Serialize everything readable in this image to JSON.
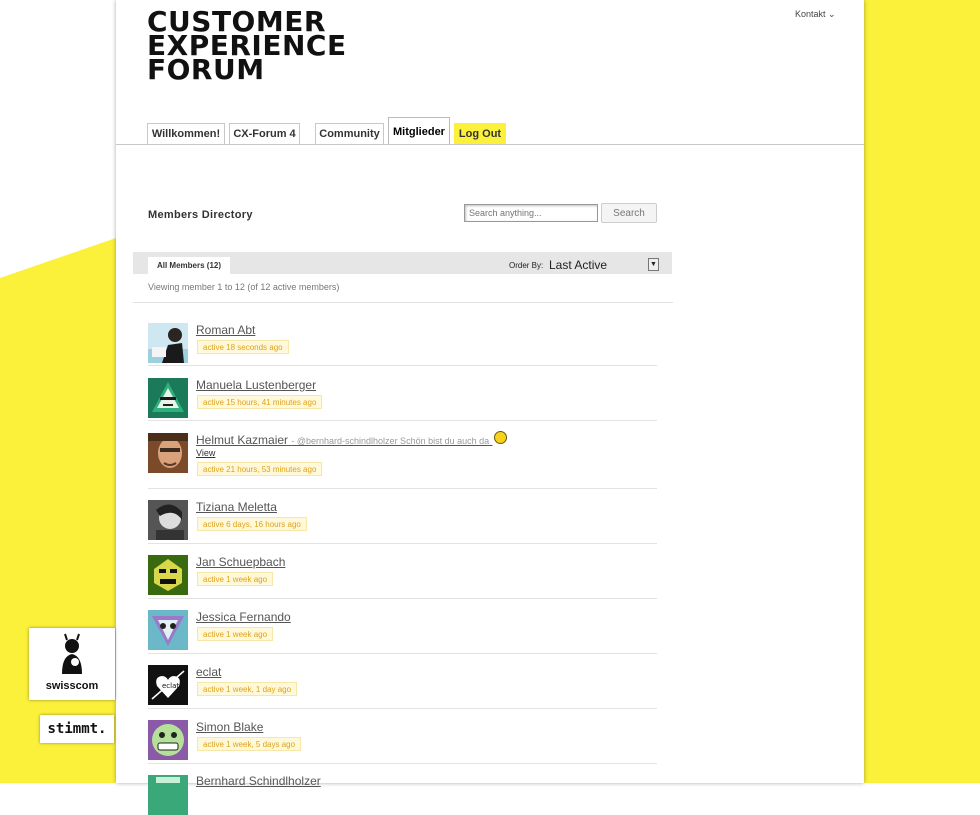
{
  "logo": {
    "lines": [
      "CUSTOMER",
      "EXPERIENCE",
      "FORUM"
    ]
  },
  "header": {
    "kontakt": "Kontakt ⌄"
  },
  "nav": {
    "tabs": [
      {
        "label": "Willkommen!"
      },
      {
        "label": "CX-Forum 4"
      },
      {
        "label": "Community"
      },
      {
        "label": "Mitglieder"
      },
      {
        "label": "Log Out"
      }
    ],
    "active": "Mitglieder"
  },
  "directory": {
    "title": "Members Directory",
    "search_placeholder": "Search anything...",
    "search_button": "Search",
    "filter_tab": "All Members (12)",
    "order_label": "Order By:",
    "order_value": "Last Active",
    "viewing": "Viewing member 1 to 12 (of 12 active members)"
  },
  "members": [
    {
      "name": "Roman Abt",
      "activity": "active 18 seconds ago"
    },
    {
      "name": "Manuela Lustenberger",
      "activity": "active 15 hours, 41 minutes ago"
    },
    {
      "name": "Helmut Kazmaier",
      "status": "- @bernhard-schindlholzer Schön bist du auch da",
      "view": "View",
      "activity": "active 21 hours, 53 minutes ago"
    },
    {
      "name": "Tiziana Meletta",
      "activity": "active 6 days, 16 hours ago"
    },
    {
      "name": "Jan Schuepbach",
      "activity": "active 1 week ago"
    },
    {
      "name": "Jessica Fernando",
      "activity": "active 1 week ago"
    },
    {
      "name": "eclat",
      "activity": "active 1 week, 1 day ago"
    },
    {
      "name": "Simon Blake",
      "activity": "active 1 week, 5 days ago"
    },
    {
      "name": "Bernhard Schindlholzer"
    }
  ],
  "sponsors": {
    "swisscom": "swisscom",
    "stimmt": "stimmt."
  },
  "colors": {
    "accent_yellow": "#fbf03a",
    "activity_text": "#e0a11a"
  }
}
